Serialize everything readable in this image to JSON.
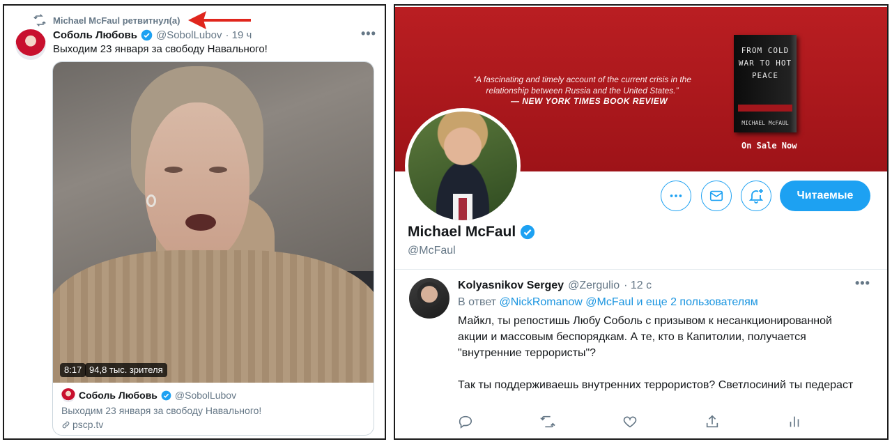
{
  "left": {
    "retweet_label": "Michael McFaul ретвитнул(а)",
    "tweet": {
      "author_name": "Соболь Любовь",
      "author_handle": "@SobolLubov",
      "time": "· 19 ч",
      "text": "Выходим 23 января за свободу Навального!",
      "video_duration": "8:17",
      "video_viewers": "94,8 тыс. зрителя"
    },
    "quote": {
      "author_name": "Соболь Любовь",
      "author_handle": "@SobolLubov",
      "text": "Выходим 23 января за свободу Навального!",
      "link": "pscp.tv"
    },
    "more_label": "•••"
  },
  "right": {
    "banner": {
      "quote": "“A fascinating and timely account of the current crisis in the relationship between Russia and the United States.”",
      "source": "— NEW YORK TIMES BOOK REVIEW",
      "book_title": "FROM COLD WAR TO HOT PEACE",
      "book_author": "MICHAEL McFAUL",
      "on_sale": "On Sale Now"
    },
    "profile": {
      "name": "Michael McFaul",
      "handle": "@McFaul",
      "follow_button": "Читаемые"
    },
    "reply": {
      "author_name": "Kolyasnikov Sergey",
      "author_handle": "@Zergulio",
      "time": "· 12 с",
      "reply_prefix": "В ответ",
      "mentions": "@NickRomanow @McFaul",
      "reply_suffix": "и еще 2 пользователям",
      "paragraph1": "Майкл, ты репостишь Любу Соболь с призывом к несанкционированной акции и массовым беспорядкам. А те, кто в Капитолии, получается \"внутренние террористы\"?",
      "paragraph2": "Так ты поддерживаешь внутренних террористов? Светлосиний ты педераст"
    },
    "more_label": "•••"
  },
  "colors": {
    "accent": "#1da1f2",
    "banner_red": "#ba1e22",
    "arrow_red": "#e0261d",
    "muted": "#657786"
  },
  "icons": [
    "retweet-icon",
    "verified-icon",
    "more-icon",
    "message-icon",
    "bell-plus-icon",
    "reply-icon",
    "like-icon",
    "share-icon",
    "analytics-icon",
    "link-icon"
  ]
}
